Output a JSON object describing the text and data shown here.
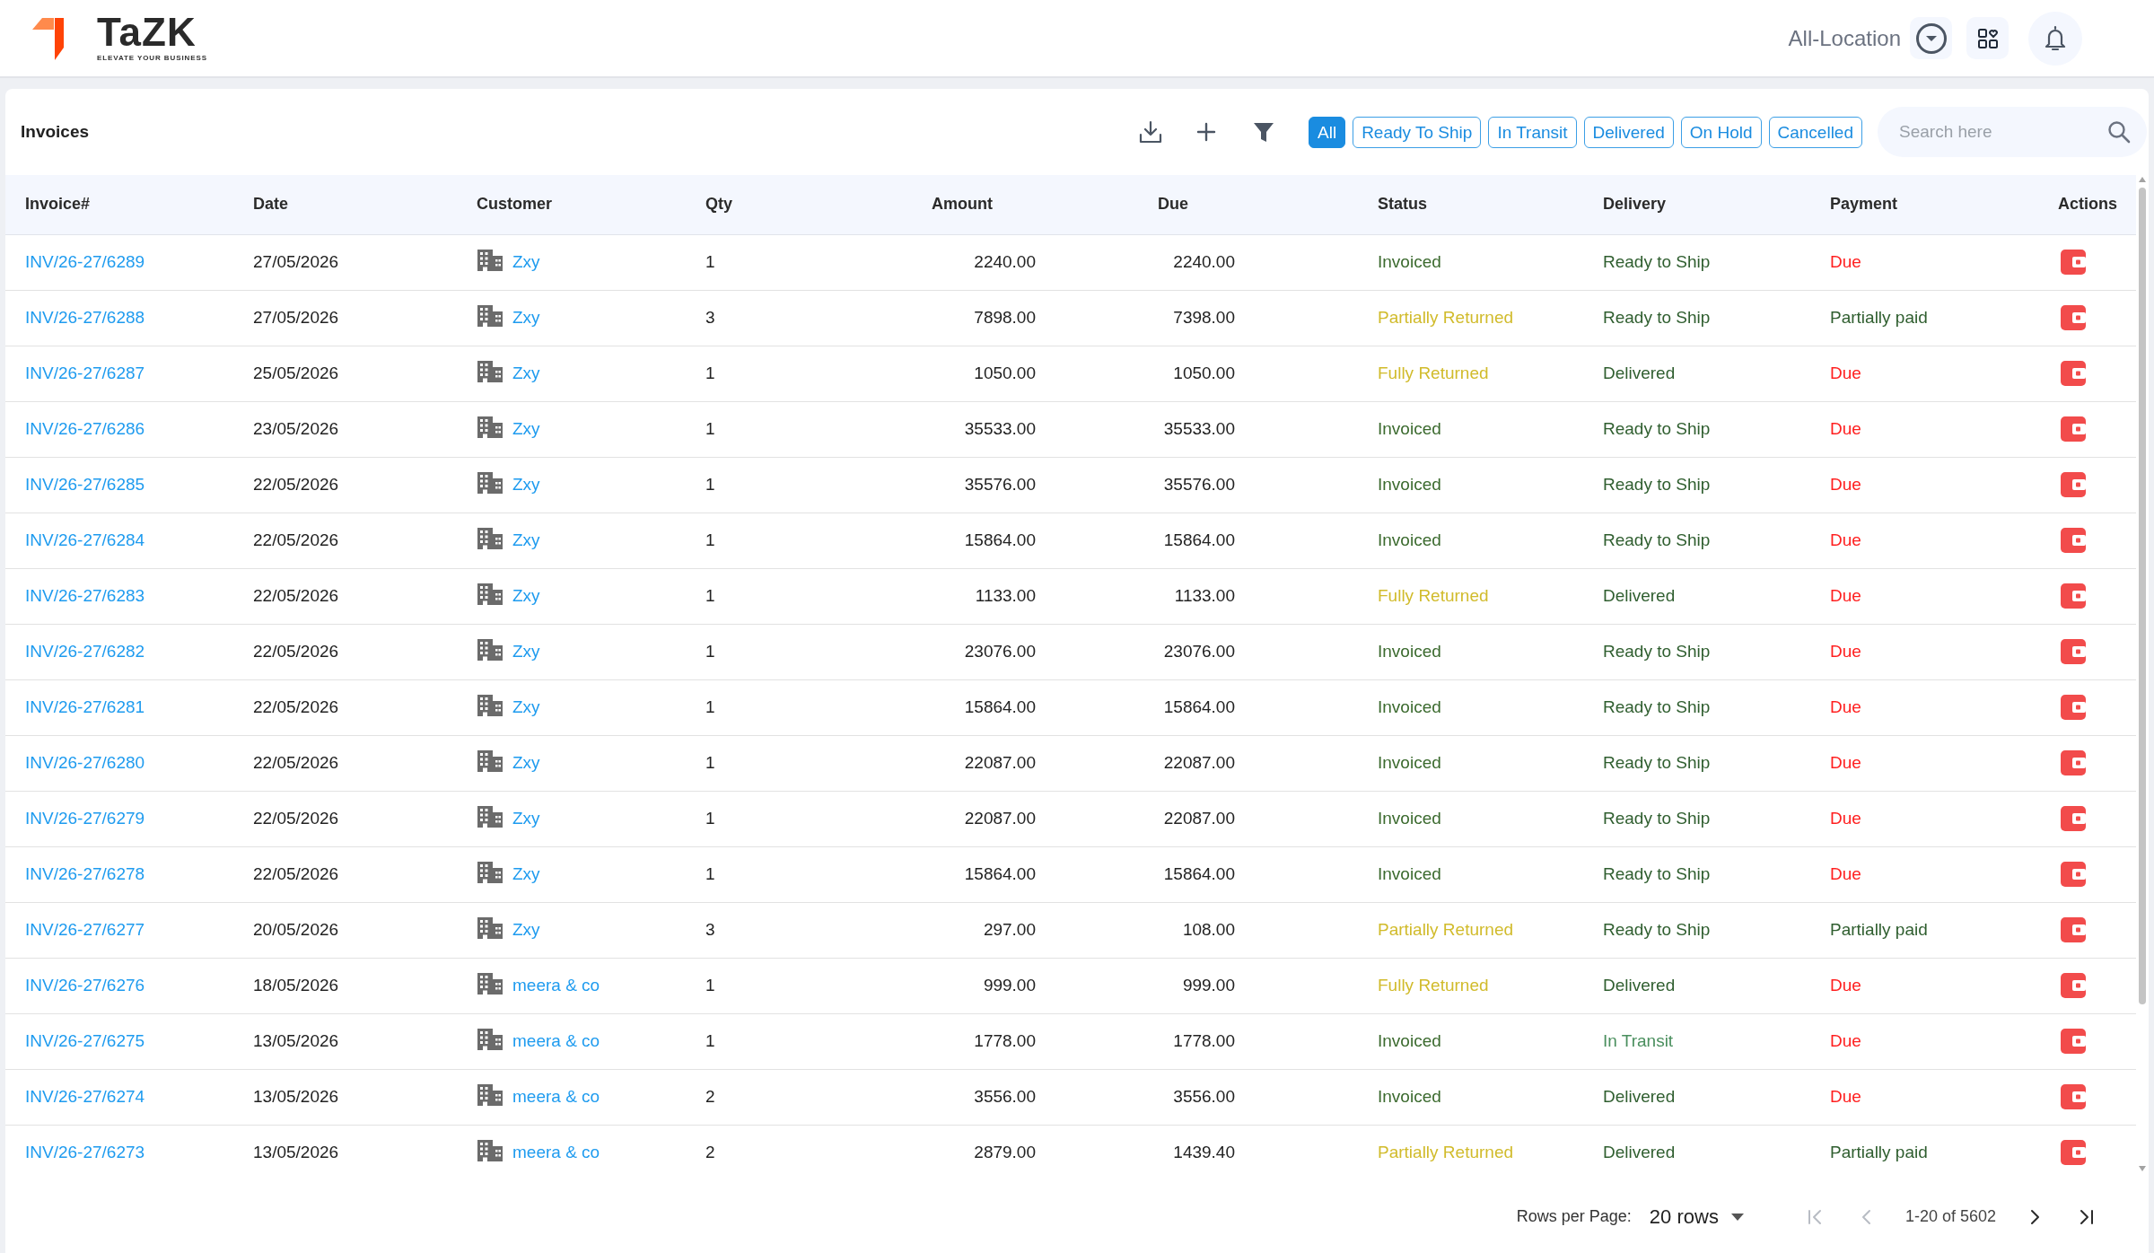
{
  "header": {
    "logo_text": "TaZK",
    "tagline": "ELEVATE YOUR BUSINESS",
    "location": "All-Location"
  },
  "page": {
    "title": "Invoices"
  },
  "filters": [
    {
      "label": "All",
      "selected": true
    },
    {
      "label": "Ready To Ship",
      "selected": false
    },
    {
      "label": "In Transit",
      "selected": false
    },
    {
      "label": "Delivered",
      "selected": false
    },
    {
      "label": "On Hold",
      "selected": false
    },
    {
      "label": "Cancelled",
      "selected": false
    }
  ],
  "search": {
    "placeholder": "Search here"
  },
  "table": {
    "columns": [
      "Invoice#",
      "Date",
      "Customer",
      "Qty",
      "Amount",
      "Due",
      "Status",
      "Delivery",
      "Payment",
      "Actions"
    ],
    "rows": [
      {
        "invoice": "INV/26-27/6289",
        "date": "27/05/2026",
        "customer": "Zxy",
        "qty": "1",
        "amount": "2240.00",
        "due": "2240.00",
        "status": {
          "label": "Invoiced",
          "color": "#3b6a2e"
        },
        "delivery": {
          "label": "Ready to Ship",
          "color": "#2f5e2f"
        },
        "payment": {
          "label": "Due",
          "color": "#ff1f1f"
        }
      },
      {
        "invoice": "INV/26-27/6288",
        "date": "27/05/2026",
        "customer": "Zxy",
        "qty": "3",
        "amount": "7898.00",
        "due": "7398.00",
        "status": {
          "label": "Partially Returned",
          "color": "#d1bb2b"
        },
        "delivery": {
          "label": "Ready to Ship",
          "color": "#2f5e2f"
        },
        "payment": {
          "label": "Partially paid",
          "color": "#2f5e2f"
        }
      },
      {
        "invoice": "INV/26-27/6287",
        "date": "25/05/2026",
        "customer": "Zxy",
        "qty": "1",
        "amount": "1050.00",
        "due": "1050.00",
        "status": {
          "label": "Fully Returned",
          "color": "#d1bb2b"
        },
        "delivery": {
          "label": "Delivered",
          "color": "#2f5e2f"
        },
        "payment": {
          "label": "Due",
          "color": "#ff1f1f"
        }
      },
      {
        "invoice": "INV/26-27/6286",
        "date": "23/05/2026",
        "customer": "Zxy",
        "qty": "1",
        "amount": "35533.00",
        "due": "35533.00",
        "status": {
          "label": "Invoiced",
          "color": "#3b6a2e"
        },
        "delivery": {
          "label": "Ready to Ship",
          "color": "#2f5e2f"
        },
        "payment": {
          "label": "Due",
          "color": "#ff1f1f"
        }
      },
      {
        "invoice": "INV/26-27/6285",
        "date": "22/05/2026",
        "customer": "Zxy",
        "qty": "1",
        "amount": "35576.00",
        "due": "35576.00",
        "status": {
          "label": "Invoiced",
          "color": "#3b6a2e"
        },
        "delivery": {
          "label": "Ready to Ship",
          "color": "#2f5e2f"
        },
        "payment": {
          "label": "Due",
          "color": "#ff1f1f"
        }
      },
      {
        "invoice": "INV/26-27/6284",
        "date": "22/05/2026",
        "customer": "Zxy",
        "qty": "1",
        "amount": "15864.00",
        "due": "15864.00",
        "status": {
          "label": "Invoiced",
          "color": "#3b6a2e"
        },
        "delivery": {
          "label": "Ready to Ship",
          "color": "#2f5e2f"
        },
        "payment": {
          "label": "Due",
          "color": "#ff1f1f"
        }
      },
      {
        "invoice": "INV/26-27/6283",
        "date": "22/05/2026",
        "customer": "Zxy",
        "qty": "1",
        "amount": "1133.00",
        "due": "1133.00",
        "status": {
          "label": "Fully Returned",
          "color": "#d1bb2b"
        },
        "delivery": {
          "label": "Delivered",
          "color": "#2f5e2f"
        },
        "payment": {
          "label": "Due",
          "color": "#ff1f1f"
        }
      },
      {
        "invoice": "INV/26-27/6282",
        "date": "22/05/2026",
        "customer": "Zxy",
        "qty": "1",
        "amount": "23076.00",
        "due": "23076.00",
        "status": {
          "label": "Invoiced",
          "color": "#3b6a2e"
        },
        "delivery": {
          "label": "Ready to Ship",
          "color": "#2f5e2f"
        },
        "payment": {
          "label": "Due",
          "color": "#ff1f1f"
        }
      },
      {
        "invoice": "INV/26-27/6281",
        "date": "22/05/2026",
        "customer": "Zxy",
        "qty": "1",
        "amount": "15864.00",
        "due": "15864.00",
        "status": {
          "label": "Invoiced",
          "color": "#3b6a2e"
        },
        "delivery": {
          "label": "Ready to Ship",
          "color": "#2f5e2f"
        },
        "payment": {
          "label": "Due",
          "color": "#ff1f1f"
        }
      },
      {
        "invoice": "INV/26-27/6280",
        "date": "22/05/2026",
        "customer": "Zxy",
        "qty": "1",
        "amount": "22087.00",
        "due": "22087.00",
        "status": {
          "label": "Invoiced",
          "color": "#3b6a2e"
        },
        "delivery": {
          "label": "Ready to Ship",
          "color": "#2f5e2f"
        },
        "payment": {
          "label": "Due",
          "color": "#ff1f1f"
        }
      },
      {
        "invoice": "INV/26-27/6279",
        "date": "22/05/2026",
        "customer": "Zxy",
        "qty": "1",
        "amount": "22087.00",
        "due": "22087.00",
        "status": {
          "label": "Invoiced",
          "color": "#3b6a2e"
        },
        "delivery": {
          "label": "Ready to Ship",
          "color": "#2f5e2f"
        },
        "payment": {
          "label": "Due",
          "color": "#ff1f1f"
        }
      },
      {
        "invoice": "INV/26-27/6278",
        "date": "22/05/2026",
        "customer": "Zxy",
        "qty": "1",
        "amount": "15864.00",
        "due": "15864.00",
        "status": {
          "label": "Invoiced",
          "color": "#3b6a2e"
        },
        "delivery": {
          "label": "Ready to Ship",
          "color": "#2f5e2f"
        },
        "payment": {
          "label": "Due",
          "color": "#ff1f1f"
        }
      },
      {
        "invoice": "INV/26-27/6277",
        "date": "20/05/2026",
        "customer": "Zxy",
        "qty": "3",
        "amount": "297.00",
        "due": "108.00",
        "status": {
          "label": "Partially Returned",
          "color": "#d1bb2b"
        },
        "delivery": {
          "label": "Ready to Ship",
          "color": "#2f5e2f"
        },
        "payment": {
          "label": "Partially paid",
          "color": "#2f5e2f"
        }
      },
      {
        "invoice": "INV/26-27/6276",
        "date": "18/05/2026",
        "customer": "meera & co",
        "qty": "1",
        "amount": "999.00",
        "due": "999.00",
        "status": {
          "label": "Fully Returned",
          "color": "#d1bb2b"
        },
        "delivery": {
          "label": "Delivered",
          "color": "#2f5e2f"
        },
        "payment": {
          "label": "Due",
          "color": "#ff1f1f"
        }
      },
      {
        "invoice": "INV/26-27/6275",
        "date": "13/05/2026",
        "customer": "meera & co",
        "qty": "1",
        "amount": "1778.00",
        "due": "1778.00",
        "status": {
          "label": "Invoiced",
          "color": "#3b6a2e"
        },
        "delivery": {
          "label": "In Transit",
          "color": "#4a8f5e"
        },
        "payment": {
          "label": "Due",
          "color": "#ff1f1f"
        }
      },
      {
        "invoice": "INV/26-27/6274",
        "date": "13/05/2026",
        "customer": "meera & co",
        "qty": "2",
        "amount": "3556.00",
        "due": "3556.00",
        "status": {
          "label": "Invoiced",
          "color": "#3b6a2e"
        },
        "delivery": {
          "label": "Delivered",
          "color": "#2f5e2f"
        },
        "payment": {
          "label": "Due",
          "color": "#ff1f1f"
        }
      },
      {
        "invoice": "INV/26-27/6273",
        "date": "13/05/2026",
        "customer": "meera & co",
        "qty": "2",
        "amount": "2879.00",
        "due": "1439.40",
        "status": {
          "label": "Partially Returned",
          "color": "#d1bb2b"
        },
        "delivery": {
          "label": "Delivered",
          "color": "#2f5e2f"
        },
        "payment": {
          "label": "Partially paid",
          "color": "#2f5e2f"
        }
      }
    ]
  },
  "pagination": {
    "rows_per_page_label": "Rows per Page:",
    "rows_per_page": "20 rows",
    "range": "1-20 of 5602",
    "buttons": [
      {
        "kind": "first",
        "disabled": true
      },
      {
        "kind": "previous",
        "disabled": true
      },
      {
        "kind": "next",
        "disabled": false
      },
      {
        "kind": "last",
        "disabled": false
      }
    ]
  }
}
